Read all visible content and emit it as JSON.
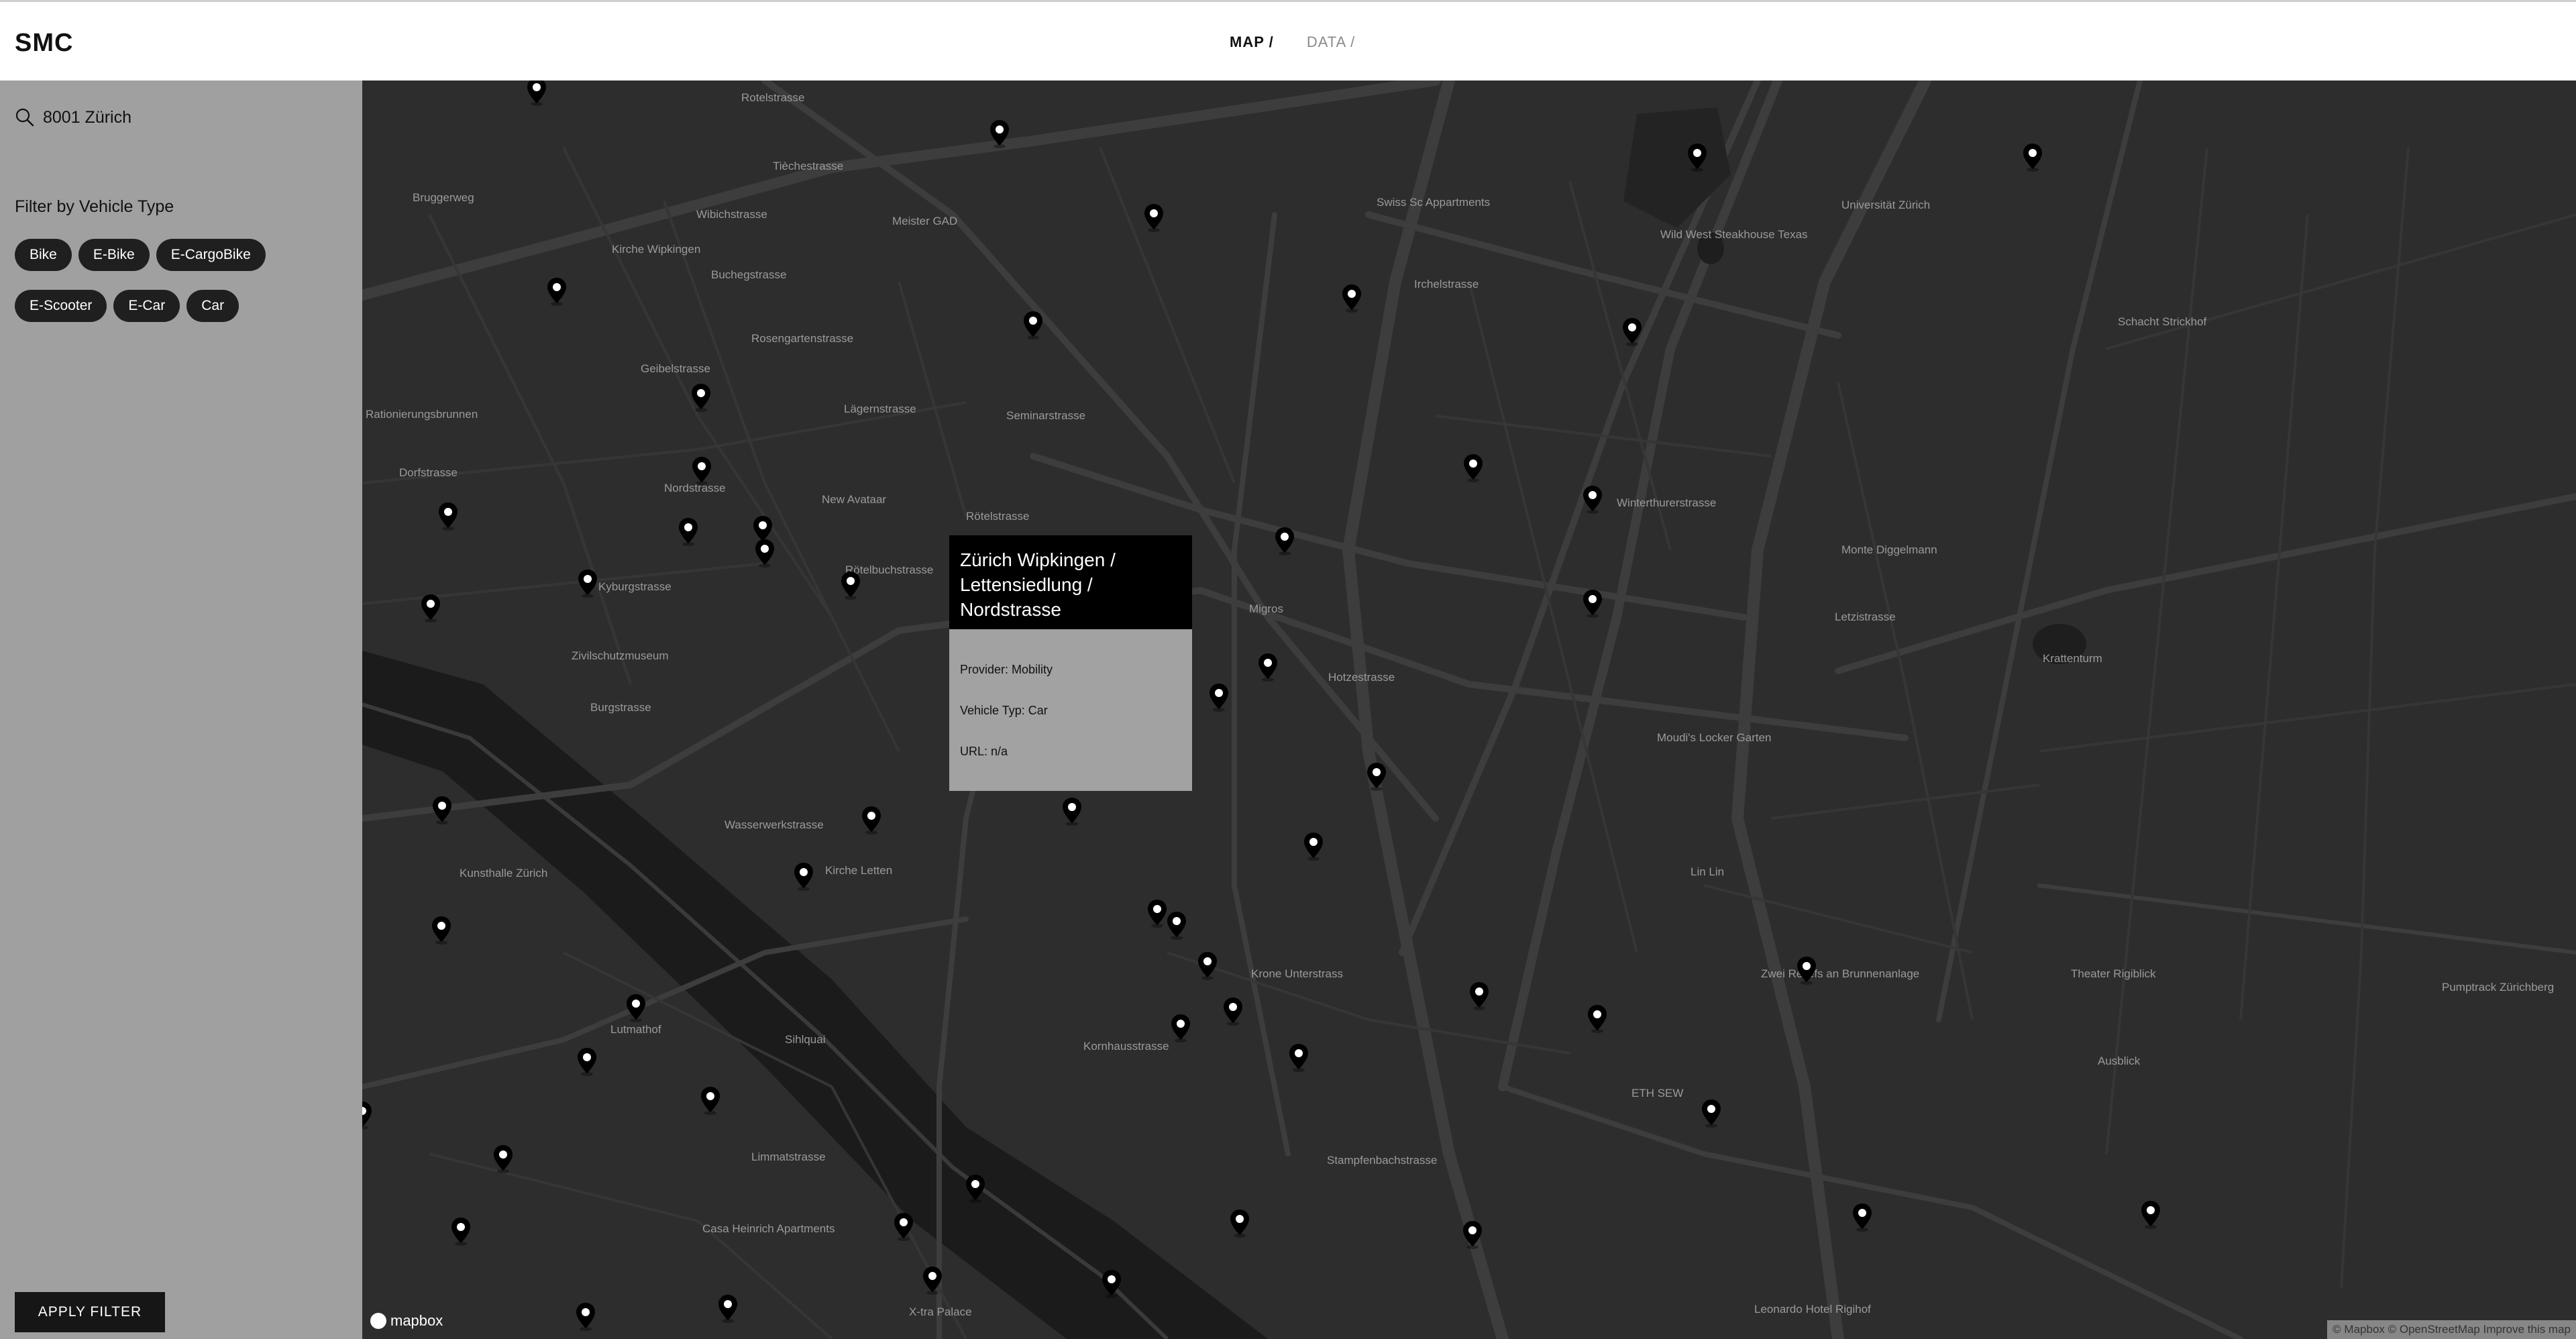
{
  "app": {
    "logo": "SMC"
  },
  "nav": {
    "map": "MAP /",
    "data": "DATA /"
  },
  "sidebar": {
    "search_value": "8001 Zürich",
    "filter_title": "Filter by Vehicle Type",
    "chips_row1": [
      "Bike",
      "E-Bike",
      "E-CargoBike"
    ],
    "chips_row2": [
      "E-Scooter",
      "E-Car",
      "Car"
    ],
    "apply_label": "APPLY FILTER"
  },
  "popup": {
    "title": "Zürich Wipkingen / Lettensiedlung / Nordstrasse",
    "provider": "Provider: Mobility",
    "vehicle_type": "Vehicle Typ: Car",
    "url": "URL: n/a"
  },
  "map": {
    "attribution": "© Mapbox © OpenStreetMap Improve this map",
    "logo_text": "mapbox",
    "labels": [
      "Tièchestrasse",
      "Rotelstrasse",
      "Bruggerweg",
      "Wibichstrasse",
      "Meister GAD",
      "Kirche Wipkingen",
      "Buchegstrasse",
      "Swiss Sc Appartments",
      "Irchelstrasse",
      "Universität Zürich",
      "Wild West Steakhouse Texas",
      "Schacht Strickhof",
      "Rosengartenstrasse",
      "Geibelstrasse",
      "Rationierungsbrunnen",
      "Dorfstrasse",
      "Nordstrasse",
      "New Avataar",
      "Seminarstrasse",
      "Rötelstrasse",
      "Lägernstrasse",
      "Kyburgstrasse",
      "Rötelbuchstrasse",
      "Migros",
      "Hotzestrasse",
      "Monte Diggelmann",
      "Letzistrasse",
      "Krattenturm",
      "Zivilschutzmuseum",
      "Burgstrasse",
      "Moudi's Locker Garten",
      "Wasserwerkstrasse",
      "Kirche Letten",
      "Lin Lin",
      "Kunsthalle Zürich",
      "Krone Unterstrass",
      "Zwei Reliefs an Brunnenanlage",
      "Theater Rigiblick",
      "Pumptrack Zürichberg",
      "Lutmathof",
      "Sihlquai",
      "ETH SEW",
      "Ausblick",
      "Casa Heinrich Apartments",
      "Leonardo Hotel Rigihof",
      "X-tra Palace",
      "Limmatstrasse",
      "Stampfenbachstrasse",
      "Kornhausstrasse",
      "Winterthurerstrasse"
    ]
  },
  "pin_count": 56
}
